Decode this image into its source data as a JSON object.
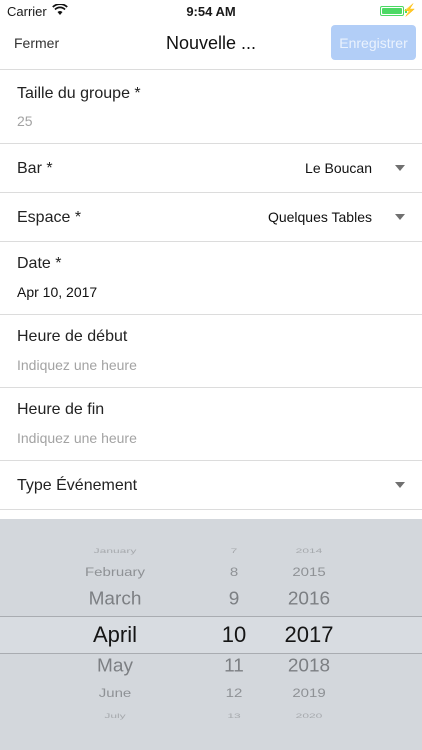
{
  "status": {
    "carrier": "Carrier",
    "time": "9:54 AM",
    "wifi_icon": "wifi-icon",
    "battery_level": 1.0
  },
  "nav": {
    "close_label": "Fermer",
    "title": "Nouvelle ...",
    "save_label": "Enregistrer"
  },
  "form": {
    "group_size": {
      "label": "Taille du groupe *",
      "placeholder": "25"
    },
    "bar": {
      "label": "Bar *",
      "value": "Le Boucan"
    },
    "space": {
      "label": "Espace *",
      "value": "Quelques Tables"
    },
    "date": {
      "label": "Date *",
      "value": "Apr 10, 2017"
    },
    "start": {
      "label": "Heure de début",
      "placeholder": "Indiquez une heure"
    },
    "end": {
      "label": "Heure de fin",
      "placeholder": "Indiquez une heure"
    },
    "event_type": {
      "label": "Type Événement"
    }
  },
  "picker": {
    "months": [
      "January",
      "February",
      "March",
      "April",
      "May",
      "June",
      "July"
    ],
    "days": [
      "7",
      "8",
      "9",
      "10",
      "11",
      "12",
      "13"
    ],
    "years": [
      "2014",
      "2015",
      "2016",
      "2017",
      "2018",
      "2019",
      "2020"
    ],
    "selected_index": 3
  }
}
